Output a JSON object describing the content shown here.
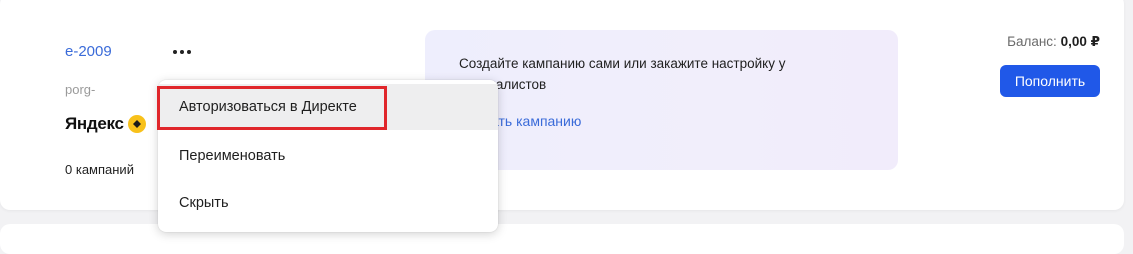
{
  "account": {
    "name": "e-2009",
    "login": "porg-",
    "logo_text": "Яндекс",
    "campaign_count": "0 кампаний"
  },
  "promo": {
    "text": "Создайте кампанию сами или закажите настройку у специалистов",
    "link": "Создать кампанию"
  },
  "balance": {
    "label": "Баланс:",
    "value": "0,00 ₽",
    "topup_label": "Пополнить"
  },
  "menu": {
    "items": [
      {
        "label": "Авторизоваться в Директе"
      },
      {
        "label": "Переименовать"
      },
      {
        "label": "Скрыть"
      }
    ]
  },
  "colors": {
    "accent": "#2058e8",
    "link": "#3a6bd9",
    "highlight": "#e0262b"
  }
}
